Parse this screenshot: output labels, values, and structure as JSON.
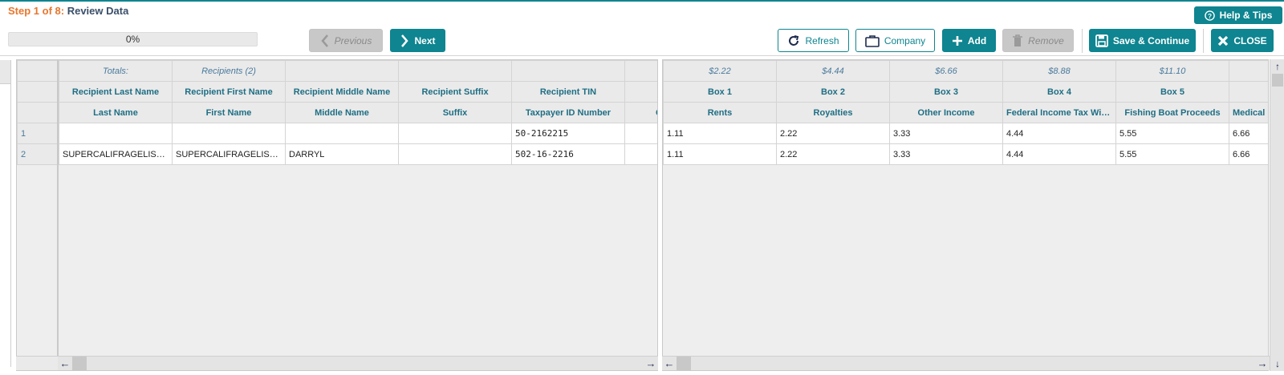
{
  "header": {
    "step_label": "Step 1 of 8:",
    "title": "Review Data",
    "help_label": "Help & Tips"
  },
  "progress": {
    "text": "0%",
    "value": 0
  },
  "toolbar": {
    "previous_label": "Previous",
    "next_label": "Next",
    "refresh_label": "Refresh",
    "company_label": "Company",
    "add_label": "Add",
    "remove_label": "Remove",
    "save_continue_label": "Save & Continue",
    "close_label": "CLOSE"
  },
  "colors": {
    "accent": "#0e8590",
    "step_orange": "#e8762d",
    "title_navy": "#3a4f6a"
  },
  "left_grid": {
    "totals": [
      "Totals:",
      "Recipients (2)",
      "",
      "",
      "",
      ""
    ],
    "headers": [
      "Recipient Last Name",
      "Recipient First Name",
      "Recipient Middle Name",
      "Recipient Suffix",
      "Recipient TIN",
      ""
    ],
    "subheaders": [
      "Last Name",
      "First Name",
      "Middle Name",
      "Suffix",
      "Taxpayer ID Number",
      "C"
    ],
    "rows": [
      [
        "",
        "",
        "",
        "",
        "50-2162215",
        ""
      ],
      [
        "SUPERCALIFRAGELISTICEXPIALIDOCIOUS",
        "SUPERCALIFRAGELISTICEXPIALIDOCIOUS",
        "DARRYL",
        "",
        "502-16-2216",
        ""
      ]
    ]
  },
  "right_grid": {
    "totals": [
      "$2.22",
      "$4.44",
      "$6.66",
      "$8.88",
      "$11.10",
      ""
    ],
    "headers": [
      "Box 1",
      "Box 2",
      "Box 3",
      "Box 4",
      "Box 5",
      ""
    ],
    "subheaders": [
      "Rents",
      "Royalties",
      "Other Income",
      "Federal Income Tax Withheld",
      "Fishing Boat Proceeds",
      "Medical"
    ],
    "rows": [
      [
        "1.11",
        "2.22",
        "3.33",
        "4.44",
        "5.55",
        "6.66"
      ],
      [
        "1.11",
        "2.22",
        "3.33",
        "4.44",
        "5.55",
        "6.66"
      ]
    ]
  },
  "row_numbers": [
    "1",
    "2"
  ]
}
